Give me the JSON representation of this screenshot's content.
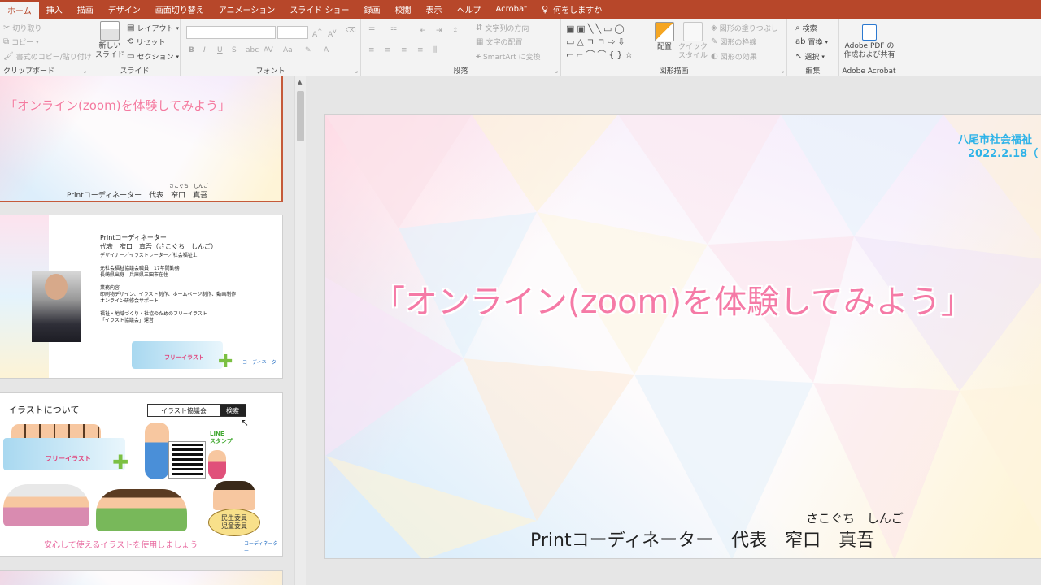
{
  "tabs": [
    {
      "label": "ホーム",
      "active": true
    },
    {
      "label": "挿入"
    },
    {
      "label": "描画"
    },
    {
      "label": "デザイン"
    },
    {
      "label": "画面切り替え"
    },
    {
      "label": "アニメーション"
    },
    {
      "label": "スライド ショー"
    },
    {
      "label": "録画"
    },
    {
      "label": "校閲"
    },
    {
      "label": "表示"
    },
    {
      "label": "ヘルプ"
    },
    {
      "label": "Acrobat"
    }
  ],
  "tell_me": "何をしますか",
  "ribbon": {
    "clipboard": {
      "cut": "切り取り",
      "copy": "コピー",
      "format_painter": "書式のコピー/貼り付け",
      "label": "クリップボード"
    },
    "slides": {
      "new_slide": "新しい\nスライド",
      "layout": "レイアウト",
      "reset": "リセット",
      "section": "セクション",
      "label": "スライド"
    },
    "font": {
      "label": "フォント"
    },
    "paragraph": {
      "text_direction": "文字列の方向",
      "align_text": "文字の配置",
      "smartart": "SmartArt に変換",
      "label": "段落"
    },
    "drawing": {
      "arrange": "配置",
      "quick_styles": "クイック\nスタイル",
      "shape_fill": "図形の塗りつぶし",
      "shape_outline": "図形の枠線",
      "shape_effects": "図形の効果",
      "label": "図形描画"
    },
    "editing": {
      "find": "検索",
      "replace": "置換",
      "select": "選択",
      "label": "編集"
    },
    "acrobat": {
      "create_pdf": "Adobe PDF の\n作成および共有",
      "label": "Adobe Acrobat"
    }
  },
  "thumbnails": {
    "slide1": {
      "title": "「オンライン(zoom)を体験してみよう」",
      "ruby": "さこぐち　しんご",
      "name": "Printコーディネーター　代表　窄口　真吾"
    },
    "slide2": {
      "lines": [
        {
          "text": "Printコーディネーター",
          "big": true
        },
        {
          "text": "代表　窄口　真吾（さこぐち　しんご）",
          "big": true
        },
        {
          "text": "デザイナー／イラストレーター／社会福祉士"
        },
        {
          "text": ""
        },
        {
          "text": "元社会福祉協議会職員　17年間勤務"
        },
        {
          "text": "長崎県出身　兵庫県三田市在住"
        },
        {
          "text": ""
        },
        {
          "text": "業務内容"
        },
        {
          "text": "印刷物デザイン、イラスト制作、ホームページ制作、動画制作"
        },
        {
          "text": "オンライン研修会サポート"
        },
        {
          "text": ""
        },
        {
          "text": "福祉・地域づくり・社協のためのフリーイラスト"
        },
        {
          "text": "「イラスト協議会」運営"
        }
      ],
      "banner": "フリーイラスト",
      "logo": "コーディネーター"
    },
    "slide3": {
      "heading": "イラストについて",
      "search_text": "イラスト協議会",
      "search_button": "検索",
      "banner": "フリーイラスト",
      "line_stamp": "LINE\nスタンプ",
      "badge_line1": "民生委員",
      "badge_line2": "児童委員",
      "footer": "安心して使えるイラストを使用しましょう",
      "logo": "コーディネーター"
    }
  },
  "slide": {
    "org": "八尾市社会福祉",
    "date": "2022.2.18（",
    "title": "「オンライン(zoom)を体験してみよう」",
    "ruby": "さこぐち しんご",
    "presenter": "Printコーディネーター　代表　窄口　真吾"
  },
  "colors": {
    "accent": "#b7472a",
    "title_pink": "#f57aa6",
    "org_blue": "#2fb3e8"
  }
}
